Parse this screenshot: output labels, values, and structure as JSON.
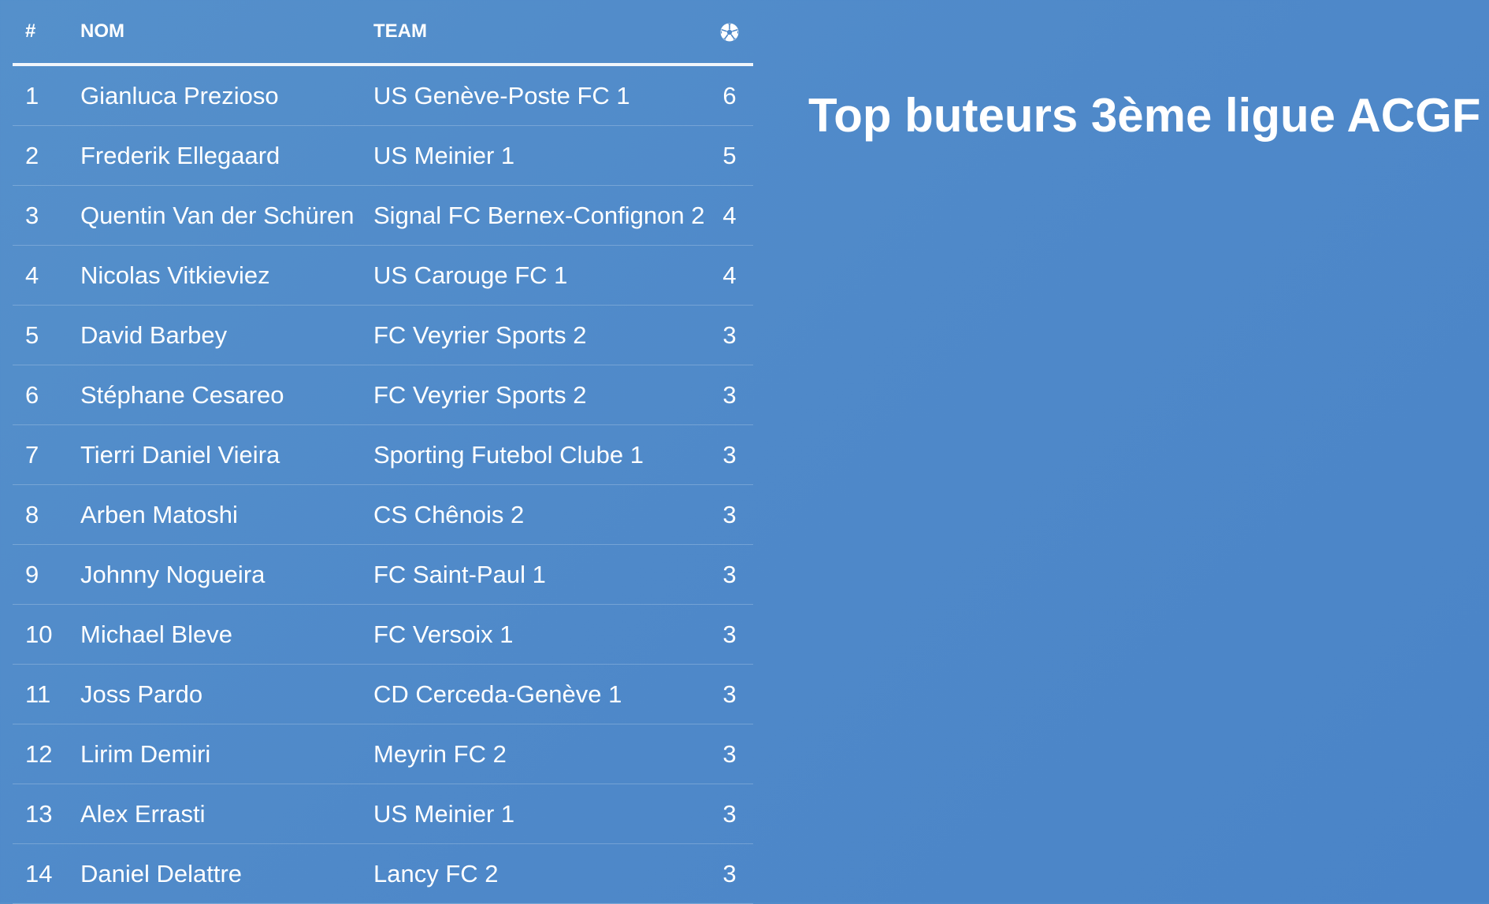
{
  "title": "Top buteurs 3ème ligue ACGF",
  "columns": {
    "rank": "#",
    "name": "NOM",
    "team": "TEAM",
    "goals_icon": "soccer-ball-icon"
  },
  "rows": [
    {
      "rank": "1",
      "name": "Gianluca Prezioso",
      "team": "US Genève-Poste FC 1",
      "goals": "6"
    },
    {
      "rank": "2",
      "name": "Frederik Ellegaard",
      "team": "US Meinier 1",
      "goals": "5"
    },
    {
      "rank": "3",
      "name": "Quentin Van der Schüren",
      "team": "Signal FC Bernex-Confignon 2",
      "goals": "4"
    },
    {
      "rank": "4",
      "name": "Nicolas Vitkieviez",
      "team": "US Carouge FC 1",
      "goals": "4"
    },
    {
      "rank": "5",
      "name": "David Barbey",
      "team": "FC Veyrier Sports 2",
      "goals": "3"
    },
    {
      "rank": "6",
      "name": "Stéphane Cesareo",
      "team": "FC Veyrier Sports 2",
      "goals": "3"
    },
    {
      "rank": "7",
      "name": "Tierri Daniel Vieira",
      "team": "Sporting Futebol Clube 1",
      "goals": "3"
    },
    {
      "rank": "8",
      "name": "Arben Matoshi",
      "team": "CS Chênois 2",
      "goals": "3"
    },
    {
      "rank": "9",
      "name": "Johnny Nogueira",
      "team": "FC Saint-Paul 1",
      "goals": "3"
    },
    {
      "rank": "10",
      "name": "Michael Bleve",
      "team": "FC Versoix 1",
      "goals": "3"
    },
    {
      "rank": "11",
      "name": "Joss Pardo",
      "team": "CD Cerceda-Genève 1",
      "goals": "3"
    },
    {
      "rank": "12",
      "name": "Lirim Demiri",
      "team": "Meyrin FC 2",
      "goals": "3"
    },
    {
      "rank": "13",
      "name": "Alex Errasti",
      "team": "US Meinier 1",
      "goals": "3"
    },
    {
      "rank": "14",
      "name": "Daniel Delattre",
      "team": "Lancy FC 2",
      "goals": "3"
    }
  ]
}
